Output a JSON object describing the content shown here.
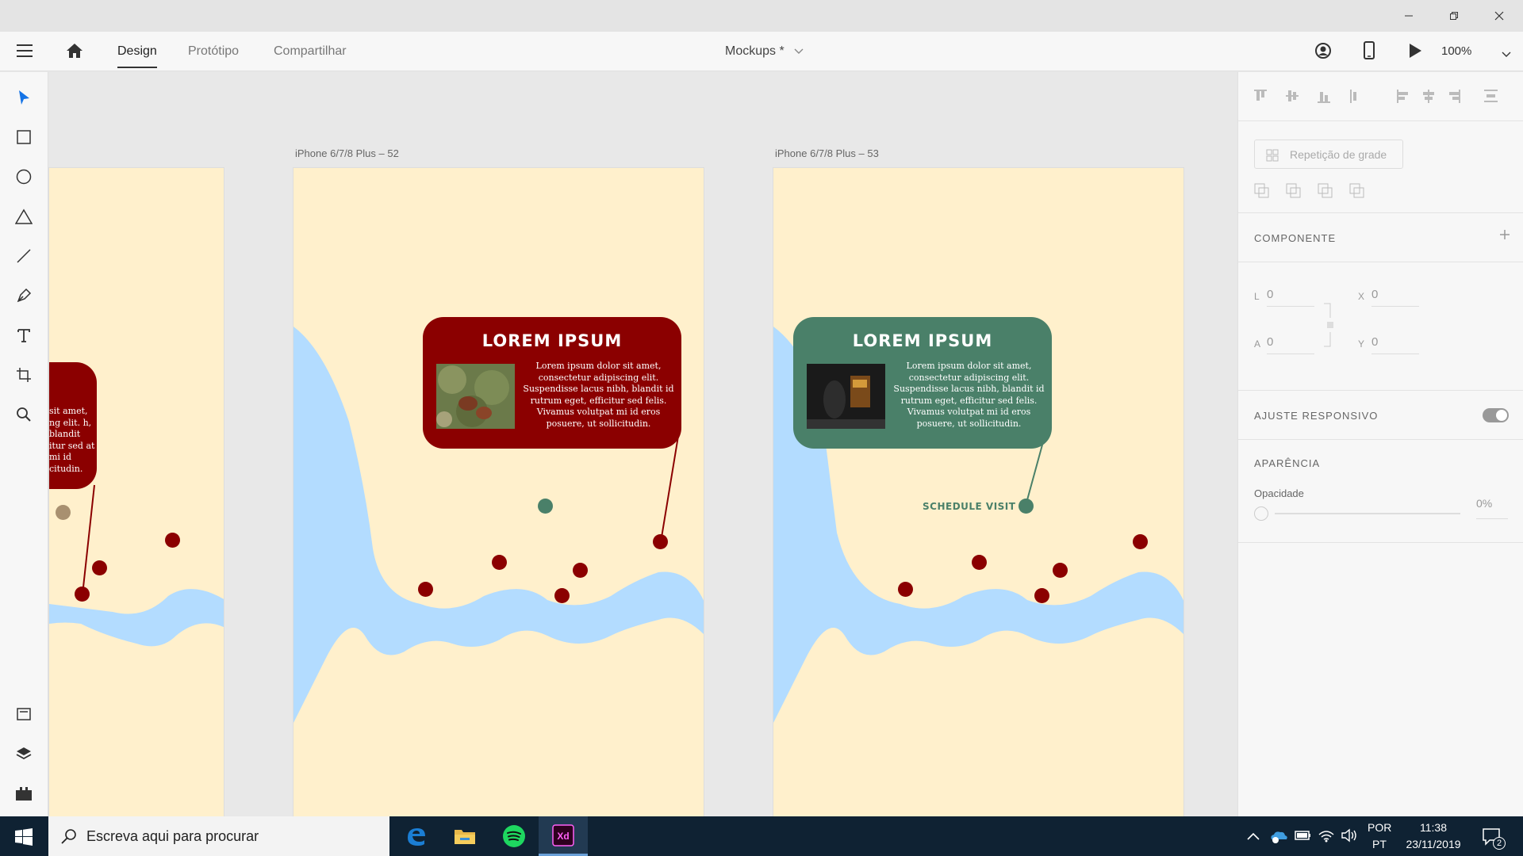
{
  "window": {
    "minimize_icon": "minimize-icon",
    "maximize_icon": "restore-icon",
    "close_icon": "close-icon"
  },
  "appbar": {
    "tabs": [
      {
        "label": "Design",
        "active": true
      },
      {
        "label": "Protótipo",
        "active": false
      },
      {
        "label": "Compartilhar",
        "active": false
      }
    ],
    "document_title": "Mockups *",
    "zoom": "100%"
  },
  "toolbar": {
    "tools": [
      "select-icon",
      "rectangle-icon",
      "ellipse-icon",
      "polygon-icon",
      "line-icon",
      "pen-icon",
      "text-icon",
      "artboard-icon",
      "zoom-icon"
    ],
    "bottom_tools": [
      "assets-icon",
      "layers-icon",
      "plugins-icon"
    ]
  },
  "artboards": [
    {
      "label": "",
      "card": {
        "title": "",
        "text": "sit amet, ng elit. h, blandit itur sed at mi id citudin.",
        "color": "#8b0000"
      }
    },
    {
      "label": "iPhone 6/7/8 Plus – 52",
      "card": {
        "title": "LOREM IPSUM",
        "text": "Lorem ipsum dolor sit amet, consectetur adipiscing elit. Suspendisse lacus nibh, blandit id rutrum eget, efficitur sed felis. Vivamus volutpat mi id eros posuere, ut sollicitudin.",
        "color": "#8b0000"
      }
    },
    {
      "label": "iPhone 6/7/8 Plus – 53",
      "card": {
        "title": "LOREM IPSUM",
        "text": "Lorem ipsum dolor sit amet, consectetur adipiscing elit. Suspendisse lacus nibh, blandit id rutrum eget, efficitur sed felis. Vivamus volutpat mi id eros posuere, ut sollicitudin.",
        "color": "#4a8069"
      },
      "marker_label": "SCHEDULE VISIT"
    }
  ],
  "colors": {
    "map_background": "#fff0cc",
    "water": "#b3dcff",
    "marker_red": "#8b0000",
    "marker_green": "#4a8069",
    "marker_tan": "#a89070"
  },
  "properties": {
    "grid_repeat_label": "Repetição de grade",
    "component_heading": "COMPONENTE",
    "fields": {
      "L": "0",
      "X": "0",
      "A": "0",
      "Y": "0"
    },
    "responsive_heading": "AJUSTE RESPONSIVO",
    "responsive_enabled": false,
    "appearance_heading": "APARÊNCIA",
    "opacity_label": "Opacidade",
    "opacity_value": "0%"
  },
  "taskbar": {
    "search_placeholder": "Escreva aqui para procurar",
    "apps": [
      "edge-icon",
      "file-explorer-icon",
      "spotify-icon",
      "adobe-xd-icon"
    ],
    "language_line1": "POR",
    "language_line2": "PT",
    "time": "11:38",
    "date": "23/11/2019",
    "notification_count": "2"
  }
}
